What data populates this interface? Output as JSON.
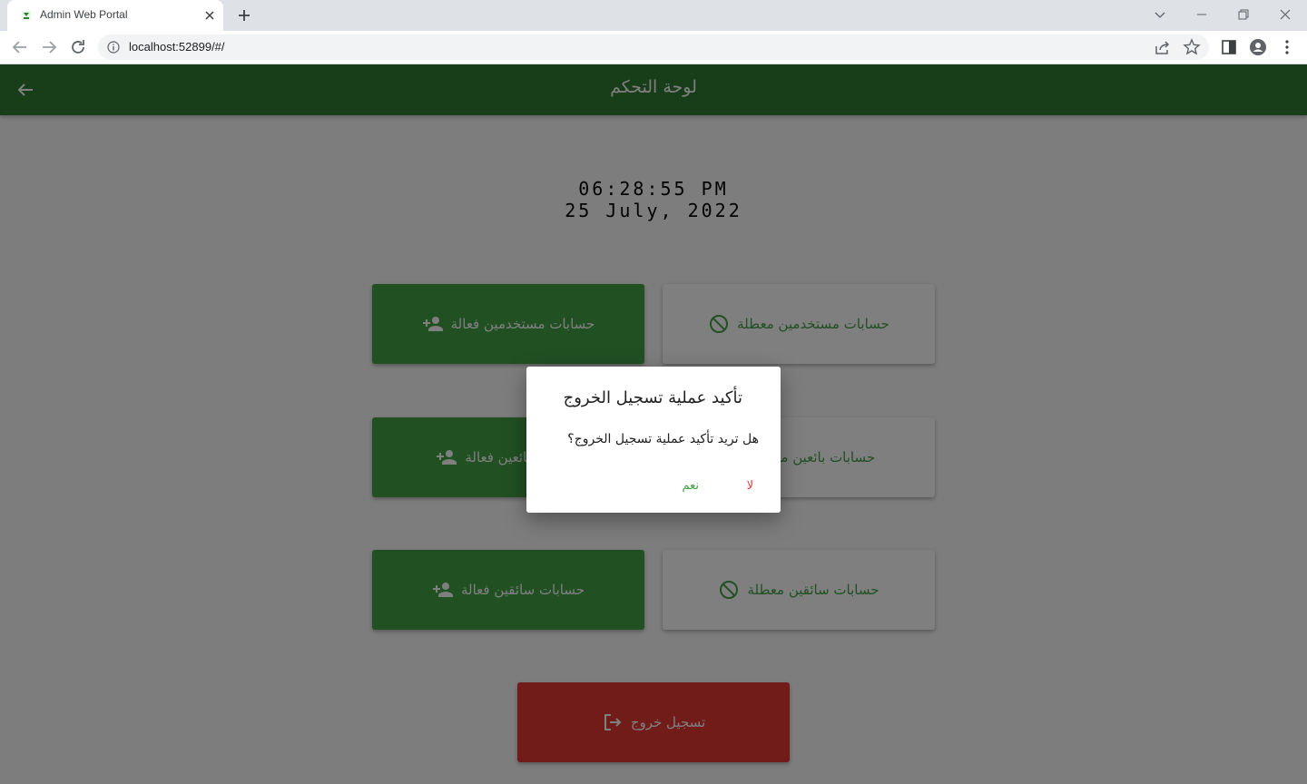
{
  "browser": {
    "tab_title": "Admin Web Portal",
    "url": "localhost:52899/#/"
  },
  "appbar": {
    "title": "لوحة التحكم"
  },
  "clock": {
    "time": "06:28:55 PM",
    "date": "25 July, 2022"
  },
  "cards": {
    "active_users": "حسابات مستخدمين فعالة",
    "blocked_users": "حسابات مستخدمين معطلة",
    "active_sellers": "حسابات بائعين فعالة",
    "blocked_sellers": "حسابات بائعين معطلة",
    "active_riders": "حسابات سائقين فعالة",
    "blocked_riders": "حسابات سائقين معطلة",
    "logout": "تسجيل خروج"
  },
  "dialog": {
    "title": "تأكيد عملية تسجيل الخروج",
    "body": "هل تريد تأكيد عملية تسجيل الخروج؟",
    "no_label": "لا",
    "yes_label": "نعم"
  },
  "colors": {
    "primary": "#2e7d32",
    "card_green": "#43a047",
    "logout_red": "#e53935"
  },
  "icons": {
    "active": "person-add-icon",
    "blocked": "block-icon",
    "logout": "logout-icon",
    "back": "arrow-back-icon"
  }
}
